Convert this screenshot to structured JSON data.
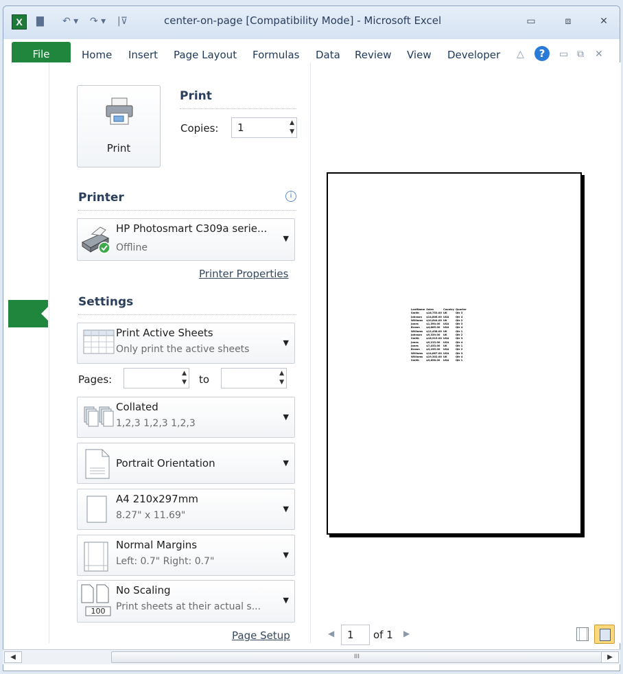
{
  "window": {
    "title": "center-on-page  [Compatibility Mode]  -  Microsoft Excel",
    "app_icon": "excel-icon",
    "qat_icons": [
      "save-icon",
      "undo-icon",
      "redo-icon",
      "customize-icon"
    ],
    "controls": [
      "minimize-icon",
      "restore-icon",
      "close-icon"
    ]
  },
  "ribbon": {
    "tabs": [
      "File",
      "Home",
      "Insert",
      "Page Layout",
      "Formulas",
      "Data",
      "Review",
      "View",
      "Developer"
    ],
    "accent": "#21863d"
  },
  "print": {
    "button_label": "Print",
    "section_title": "Print",
    "copies_label": "Copies:",
    "copies_value": "1"
  },
  "printer": {
    "section_title": "Printer",
    "name": "HP Photosmart C309a serie...",
    "status": "Offline",
    "properties_link": "Printer Properties"
  },
  "settings": {
    "section_title": "Settings",
    "active_sheets": {
      "main": "Print Active Sheets",
      "sub": "Only print the active sheets"
    },
    "pages_label": "Pages:",
    "to_label": "to",
    "pages_from": "",
    "pages_to": "",
    "collated": {
      "main": "Collated",
      "sub": "1,2,3   1,2,3   1,2,3"
    },
    "orientation": {
      "main": "Portrait Orientation"
    },
    "paper": {
      "main": "A4 210x297mm",
      "sub": "8.27\" x 11.69\""
    },
    "margins": {
      "main": "Normal Margins",
      "sub": "Left:  0.7\"    Right:  0.7\""
    },
    "scaling": {
      "main": "No Scaling",
      "sub": "Print sheets at their actual s...",
      "badge": "100"
    },
    "page_setup_link": "Page Setup"
  },
  "preview": {
    "page_number": "1",
    "page_of": "of 1",
    "table_header": [
      "LastName",
      "Sales",
      "Country",
      "Quarter"
    ],
    "table_rows": [
      [
        "Smith",
        "$16,753.00",
        "UK",
        "Qtr 3"
      ],
      [
        "Johnson",
        "$14,808.00",
        "USA",
        "Qtr 4"
      ],
      [
        "Williams",
        "$10,644.00",
        "UK",
        "Qtr 2"
      ],
      [
        "Jones",
        "$1,390.00",
        "USA",
        "Qtr 3"
      ],
      [
        "Brown",
        "$4,865.00",
        "USA",
        "Qtr 4"
      ],
      [
        "Williams",
        "$12,438.00",
        "UK",
        "Qtr 1"
      ],
      [
        "Johnson",
        "$9,339.00",
        "UK",
        "Qtr 2"
      ],
      [
        "Smith",
        "$18,919.00",
        "USA",
        "Qtr 3"
      ],
      [
        "Jones",
        "$9,213.00",
        "USA",
        "Qtr 4"
      ],
      [
        "Jones",
        "$7,433.00",
        "UK",
        "Qtr 1"
      ],
      [
        "Brown",
        "$3,255.00",
        "USA",
        "Qtr 2"
      ],
      [
        "Williams",
        "$14,867.00",
        "USA",
        "Qtr 3"
      ],
      [
        "Williams",
        "$19,302.00",
        "UK",
        "Qtr 4"
      ],
      [
        "Smith",
        "$9,698.00",
        "USA",
        "Qtr 1"
      ]
    ],
    "zoom_icons": [
      "show-margins-icon",
      "zoom-to-page-icon"
    ]
  },
  "scrollbar": {
    "thumb_grip": "III"
  }
}
